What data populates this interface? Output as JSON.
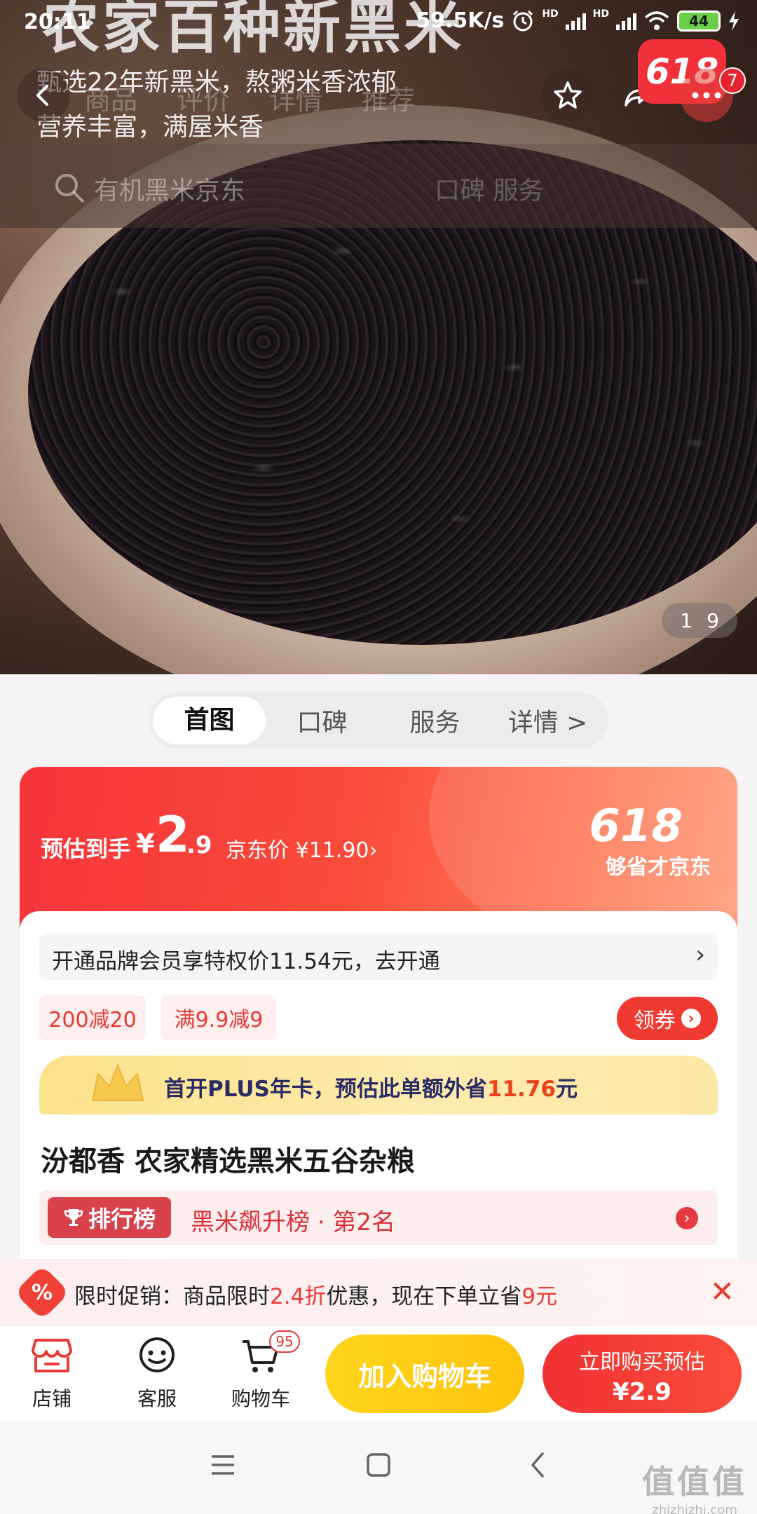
{
  "status_bar": {
    "time": "20:11",
    "net_speed": "59.5K/s",
    "sim1": "HD",
    "sim2": "HD",
    "battery": "44"
  },
  "hero": {
    "title_text": "农家百种新黑米",
    "subtitle_line1": "甄选22年新黑米，熬粥米香浓郁",
    "subtitle_line2": "营养丰富，满屋米香",
    "ghost_tabs": [
      "商品",
      "评价",
      "详情",
      "推荐"
    ],
    "search_placeholder": "有机黑米京东",
    "search_ghost_right": "口碑    服务",
    "badge_618": "618",
    "notif_count": "7",
    "image_counter_current": "1",
    "image_counter_total": "9"
  },
  "segment_tabs": {
    "items": [
      "首图",
      "口碑",
      "服务",
      "详情 >"
    ],
    "active": 0
  },
  "price_card": {
    "prefix": "预估到手",
    "currency": "¥",
    "price_int": "2",
    "price_dec": ".9",
    "jd_price": "京东价 ¥11.90",
    "jd_arrow": "›",
    "promo_logo": "618",
    "slogan": "够省才京东"
  },
  "member": {
    "text": "开通品牌会员享特权价11.54元，去开通",
    "arrow": "›"
  },
  "coupons": {
    "items": [
      "200减20",
      "满9.9减9"
    ],
    "get_label": "领券",
    "get_icon": "›"
  },
  "plus_bar": {
    "text_pre": "首开PLUS年卡，预估此单额外省",
    "amount": "11.76",
    "unit": "元"
  },
  "product": {
    "title": "汾都香 农家精选黑米五谷杂粮"
  },
  "ranking": {
    "tag": "排行榜",
    "text": "黑米飙升榜 · 第2名",
    "go": "›"
  },
  "promo": {
    "icon": "%",
    "text_pre": "限时促销：商品限时",
    "discount": "2.4折",
    "text_mid": "优惠，现在下单立省",
    "save": "9元",
    "close": "✕"
  },
  "bottom_bar": {
    "shop_label": "店铺",
    "service_label": "客服",
    "cart_label": "购物车",
    "cart_count": "95",
    "add_cart_label": "加入购物车",
    "buy_line1": "立即购买预估",
    "buy_line2": "¥2.9"
  },
  "watermark": {
    "line1": "值值值",
    "line2": "zhizhizhi.com"
  },
  "colors": {
    "accent_red": "#f03135",
    "add_cart_yellow": "#ffc40c",
    "plus_text": "#2a2c66"
  }
}
